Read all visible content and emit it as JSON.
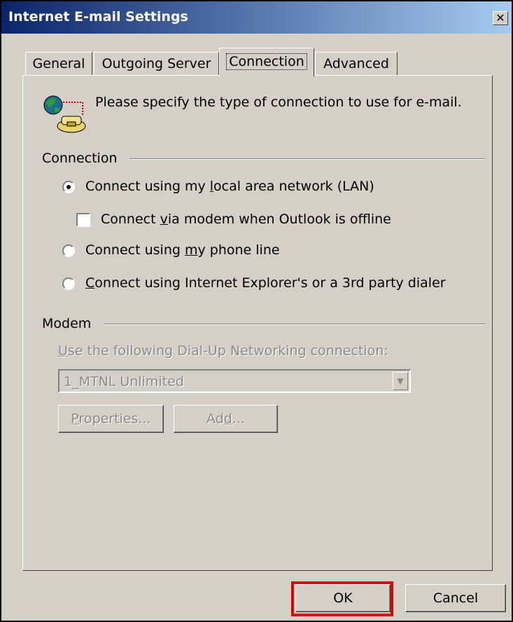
{
  "window": {
    "title": "Internet E-mail Settings",
    "close_glyph": "✕"
  },
  "tabs": [
    {
      "label": "General"
    },
    {
      "label": "Outgoing Server"
    },
    {
      "label": "Connection",
      "active": true
    },
    {
      "label": "Advanced"
    }
  ],
  "intro": {
    "text": "Please specify the type of connection to use for e-mail.",
    "icon": "globe-phone-icon"
  },
  "connection": {
    "group_label": "Connection",
    "options": [
      {
        "pre": "Connect using my ",
        "key": "l",
        "post": "ocal area network (LAN)",
        "checked": true
      },
      {
        "pre": "Connect using ",
        "key": "m",
        "post": "y phone line",
        "checked": false
      },
      {
        "pre": "",
        "key": "C",
        "post": "onnect using Internet Explorer's or a 3rd party dialer",
        "checked": false
      }
    ],
    "modem_offline": {
      "pre": "Connect ",
      "key": "v",
      "post": "ia modem when Outlook is offline",
      "checked": false
    }
  },
  "modem": {
    "group_label": "Modem",
    "dialup": {
      "key": "U",
      "post": "se the following Dial-Up Networking connection:"
    },
    "selected_connection": "1_MTNL Unlimited",
    "properties": {
      "key": "P",
      "post": "roperties..."
    },
    "add": {
      "pre": "Ad",
      "key": "d",
      "post": "..."
    }
  },
  "buttons": {
    "ok": "OK",
    "cancel": "Cancel"
  },
  "colors": {
    "dialog_bg": "#d4d0c8",
    "title_start": "#0a246a",
    "title_end": "#a6caf0",
    "highlight": "#e00000"
  }
}
